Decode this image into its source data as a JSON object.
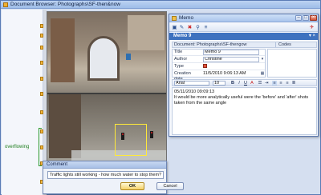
{
  "document_browser": {
    "title": "Document Browser: Photographs\\SF-then&now",
    "margin_label": "overflowing"
  },
  "comment_dialog": {
    "title": "Comment",
    "text": "Traffic lights still working - how much water to stop them?",
    "ok_label": "OK",
    "cancel_label": "Cancel"
  },
  "memo_window": {
    "title": "Memo",
    "tab_label": "Memo 9",
    "pane_controls": "▾ ×",
    "document_path": "Document: Photographs\\SF-thengow",
    "codes_header": "Codes",
    "properties": [
      {
        "label": "Title",
        "value": "Memo 9"
      },
      {
        "label": "Author",
        "value": "Christine"
      },
      {
        "label": "Type",
        "value": ""
      },
      {
        "label": "Creation date",
        "value": "11/5/2010 9:06:13 AM"
      }
    ],
    "font": "Arial",
    "font_size": "10",
    "format_buttons": [
      "B",
      "I",
      "U",
      "A"
    ],
    "body_lines": [
      "05/11/2010 09:09:13",
      "It would be more analytically useful were the 'before' and 'after' shots",
      "taken from the same angle"
    ]
  },
  "colors": {
    "accent": "#3e72bf",
    "highlight_box": "#ffe93a",
    "bracket": "#2e9a2e"
  }
}
